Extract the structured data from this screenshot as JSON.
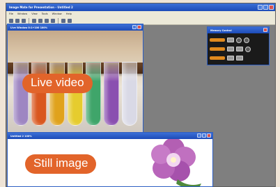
{
  "app": {
    "title": "Image Mate for Presentation - Untitled 2",
    "menu": [
      "File",
      "Window",
      "View",
      "Tools",
      "Window",
      "Help"
    ]
  },
  "windows": {
    "video": {
      "title": "Live Window 0:1+100 100%"
    },
    "still": {
      "title": "Untitled 2 100%"
    },
    "memory": {
      "title": "Memory Control"
    }
  },
  "labels": {
    "live_video": "Live video",
    "still_image": "Still image"
  },
  "tubes": [
    {
      "color": "#9e86c2"
    },
    {
      "color": "#d9571f"
    },
    {
      "color": "#e0a21c"
    },
    {
      "color": "#e6cc2e"
    },
    {
      "color": "#3fa56a"
    },
    {
      "color": "#8a4fb0"
    },
    {
      "color": "#d9d9e6"
    }
  ],
  "colors": {
    "accent": "#e2642a",
    "titlebar": "#2456c6",
    "memory_slot": "#e08a1e"
  }
}
